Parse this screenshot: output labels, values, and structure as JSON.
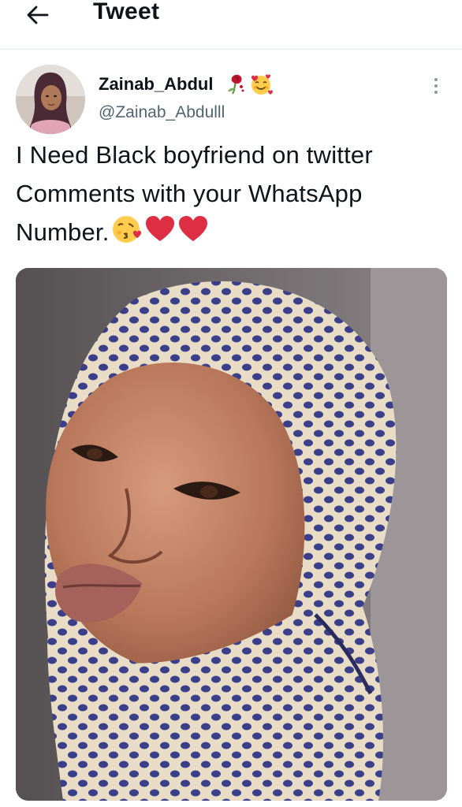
{
  "header": {
    "title": "Tweet",
    "back_icon": "arrow-left-icon"
  },
  "tweet": {
    "author": {
      "display_name": "Zainab_Abdul",
      "name_emojis": [
        "rose-wilted-icon",
        "smiling-face-with-hearts-icon"
      ],
      "handle": "@Zainab_Abdulll"
    },
    "text_lines": [
      "I Need Black boyfriend on twitter",
      "Comments with your WhatsApp",
      "Number."
    ],
    "text_emojis": [
      "face-blowing-kiss-icon",
      "red-heart-icon",
      "red-heart-icon"
    ],
    "more_icon": "vertical-ellipsis-icon"
  },
  "colors": {
    "text_primary": "#0f1419",
    "text_secondary": "#536471",
    "divider": "#e6ecf0",
    "heart": "#e0245e"
  }
}
